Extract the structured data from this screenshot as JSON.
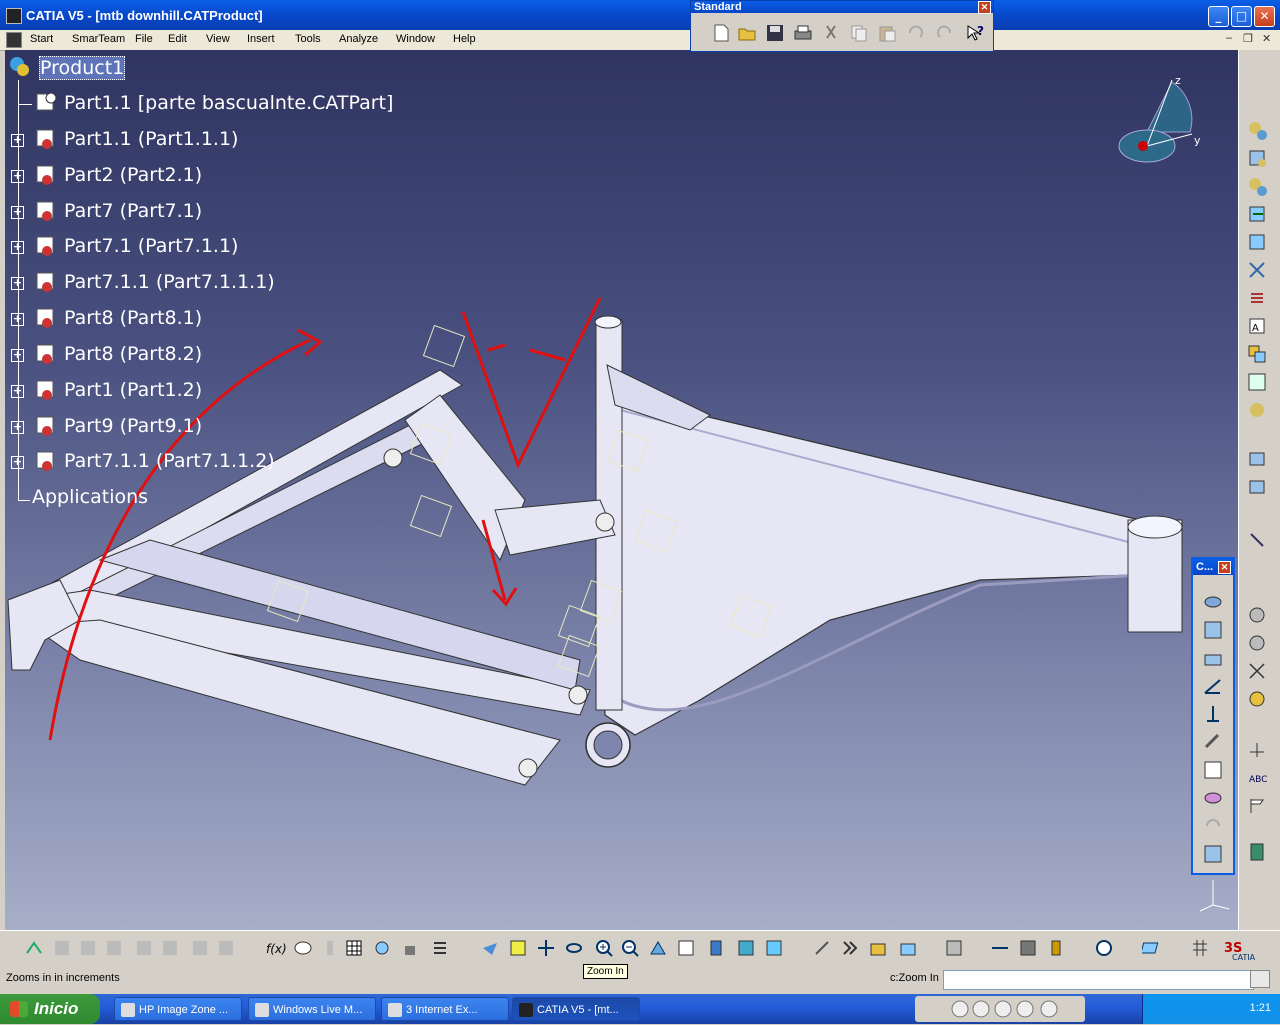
{
  "window": {
    "title": "CATIA V5 - [mtb downhill.CATProduct]",
    "controls": {
      "minimize": "_",
      "maximize": "□",
      "close": "✕"
    }
  },
  "menu": {
    "items": [
      "Start",
      "SmarTeam",
      "File",
      "Edit",
      "View",
      "Insert",
      "Tools",
      "Analyze",
      "Window",
      "Help"
    ],
    "mdi": {
      "minimize": "–",
      "restore": "❐",
      "close": "✕"
    }
  },
  "standard_toolbar": {
    "title": "Standard",
    "close": "✕",
    "icons": [
      "new-icon",
      "open-icon",
      "save-icon",
      "print-icon",
      "cut-icon",
      "copy-icon",
      "paste-icon",
      "undo-icon",
      "redo-icon",
      "whats-this-icon"
    ]
  },
  "tree": {
    "root": "Product1",
    "nodes": [
      "Part1.1 [parte bascualnte.CATPart]",
      "Part1.1 (Part1.1.1)",
      "Part2 (Part2.1)",
      "Part7 (Part7.1)",
      "Part7.1 (Part7.1.1)",
      "Part7.1.1 (Part7.1.1.1)",
      "Part8 (Part8.1)",
      "Part8 (Part8.2)",
      "Part1 (Part1.2)",
      "Part9 (Part9.1)",
      "Part7.1.1 (Part7.1.1.2)"
    ],
    "applications": "Applications"
  },
  "compass": {
    "axis_z": "z",
    "axis_y": "y"
  },
  "float_toolbar": {
    "title": "C...",
    "close": "✕"
  },
  "status": {
    "message": "Zooms in in increments",
    "tooltip": "Zoom In",
    "command_label": "c:Zoom In",
    "command_value": ""
  },
  "taskbar": {
    "start_label": "Inicio",
    "items": [
      {
        "label": "HP Image Zone ...",
        "active": false
      },
      {
        "label": "Windows Live M...",
        "active": false
      },
      {
        "label": "3 Internet Ex...",
        "active": false
      },
      {
        "label": "CATIA V5 - [mt...",
        "active": true
      }
    ],
    "clock": "1:21"
  },
  "colors": {
    "xp_blue": "#0a5ee6",
    "viewport_top": "#2f3460",
    "viewport_bottom": "#a7aec8",
    "annotation_red": "#e01010",
    "frame_fill": "#e6e6f5"
  }
}
